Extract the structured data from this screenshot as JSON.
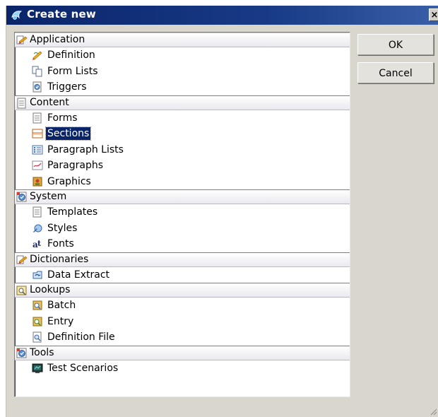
{
  "window": {
    "title": "Create new",
    "close_glyph": "×"
  },
  "buttons": {
    "ok": "OK",
    "cancel": "Cancel"
  },
  "tree": {
    "groups": [
      {
        "label": "Application",
        "icon": "application-group-icon",
        "items": [
          {
            "label": "Definition",
            "icon": "definition-icon"
          },
          {
            "label": "Form Lists",
            "icon": "form-lists-icon"
          },
          {
            "label": "Triggers",
            "icon": "triggers-icon"
          }
        ]
      },
      {
        "label": "Content",
        "icon": "content-group-icon",
        "items": [
          {
            "label": "Forms",
            "icon": "forms-icon"
          },
          {
            "label": "Sections",
            "icon": "sections-icon",
            "selected": true
          },
          {
            "label": "Paragraph Lists",
            "icon": "paragraph-lists-icon"
          },
          {
            "label": "Paragraphs",
            "icon": "paragraphs-icon"
          },
          {
            "label": "Graphics",
            "icon": "graphics-icon"
          }
        ]
      },
      {
        "label": "System",
        "icon": "system-group-icon",
        "items": [
          {
            "label": "Templates",
            "icon": "templates-icon"
          },
          {
            "label": "Styles",
            "icon": "styles-icon"
          },
          {
            "label": "Fonts",
            "icon": "fonts-icon"
          }
        ]
      },
      {
        "label": "Dictionaries",
        "icon": "dictionaries-group-icon",
        "items": [
          {
            "label": "Data Extract",
            "icon": "data-extract-icon"
          }
        ]
      },
      {
        "label": "Lookups",
        "icon": "lookups-group-icon",
        "items": [
          {
            "label": "Batch",
            "icon": "batch-icon"
          },
          {
            "label": "Entry",
            "icon": "entry-icon"
          },
          {
            "label": "Definition File",
            "icon": "definition-file-icon"
          }
        ]
      },
      {
        "label": "Tools",
        "icon": "tools-group-icon",
        "items": [
          {
            "label": "Test Scenarios",
            "icon": "test-scenarios-icon"
          }
        ]
      }
    ]
  },
  "colors": {
    "titlebar": "#0a246a",
    "selection": "#0a246a",
    "dialog_bg": "#d9d6cd"
  }
}
